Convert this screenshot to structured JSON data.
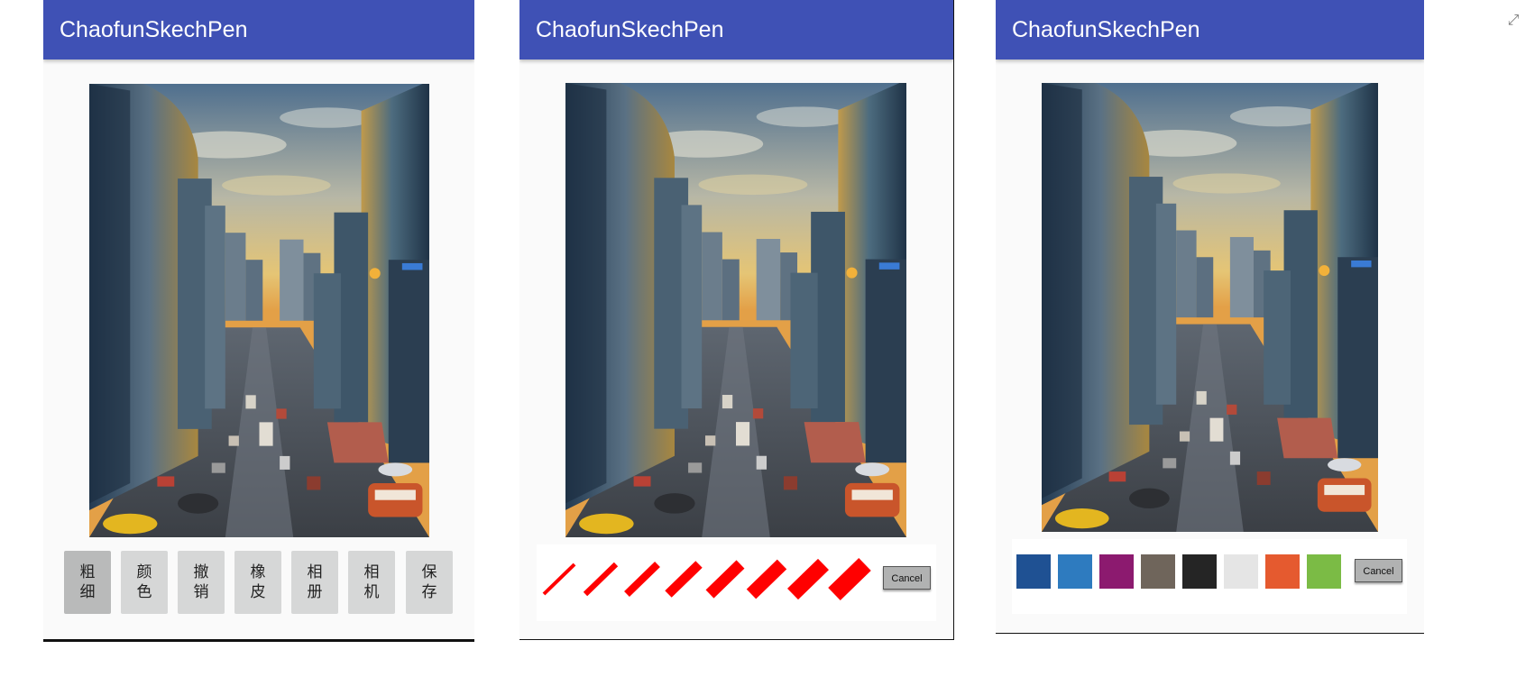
{
  "screens": [
    {
      "app_title": "ChaofunSkechPen",
      "tools": [
        {
          "line1": "粗",
          "line2": "细"
        },
        {
          "line1": "颜",
          "line2": "色"
        },
        {
          "line1": "撤",
          "line2": "销"
        },
        {
          "line1": "橡",
          "line2": "皮"
        },
        {
          "line1": "相",
          "line2": "册"
        },
        {
          "line1": "相",
          "line2": "机"
        },
        {
          "line1": "保",
          "line2": "存"
        }
      ],
      "active_tool": "粗细"
    },
    {
      "app_title": "ChaofunSkechPen",
      "brush_sizes_count": 8,
      "brush_color": "#ff0000",
      "cancel_label": "Cancel"
    },
    {
      "app_title": "ChaofunSkechPen",
      "colors": [
        "#1f5193",
        "#2e7bbf",
        "#8c1a6f",
        "#6f655b",
        "#252525",
        "#e5e5e5",
        "#e55a2f",
        "#7bbb45"
      ],
      "cancel_label": "Cancel"
    }
  ],
  "icons": {
    "expand": "expand-icon"
  }
}
